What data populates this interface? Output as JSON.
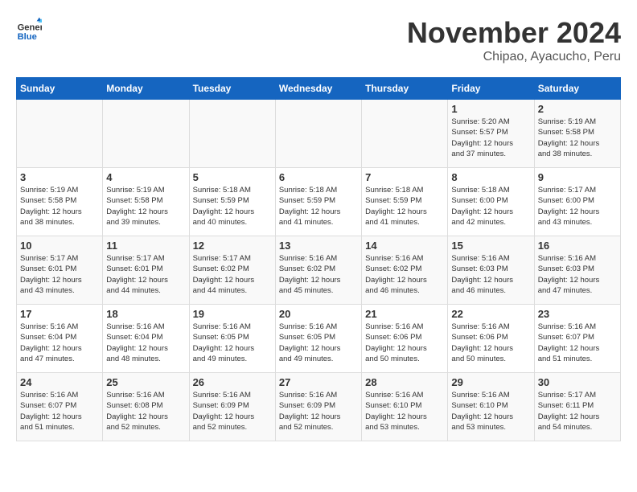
{
  "header": {
    "logo_general": "General",
    "logo_blue": "Blue",
    "month": "November 2024",
    "location": "Chipao, Ayacucho, Peru"
  },
  "days_of_week": [
    "Sunday",
    "Monday",
    "Tuesday",
    "Wednesday",
    "Thursday",
    "Friday",
    "Saturday"
  ],
  "weeks": [
    [
      {
        "day": "",
        "detail": ""
      },
      {
        "day": "",
        "detail": ""
      },
      {
        "day": "",
        "detail": ""
      },
      {
        "day": "",
        "detail": ""
      },
      {
        "day": "",
        "detail": ""
      },
      {
        "day": "1",
        "detail": "Sunrise: 5:20 AM\nSunset: 5:57 PM\nDaylight: 12 hours\nand 37 minutes."
      },
      {
        "day": "2",
        "detail": "Sunrise: 5:19 AM\nSunset: 5:58 PM\nDaylight: 12 hours\nand 38 minutes."
      }
    ],
    [
      {
        "day": "3",
        "detail": "Sunrise: 5:19 AM\nSunset: 5:58 PM\nDaylight: 12 hours\nand 38 minutes."
      },
      {
        "day": "4",
        "detail": "Sunrise: 5:19 AM\nSunset: 5:58 PM\nDaylight: 12 hours\nand 39 minutes."
      },
      {
        "day": "5",
        "detail": "Sunrise: 5:18 AM\nSunset: 5:59 PM\nDaylight: 12 hours\nand 40 minutes."
      },
      {
        "day": "6",
        "detail": "Sunrise: 5:18 AM\nSunset: 5:59 PM\nDaylight: 12 hours\nand 41 minutes."
      },
      {
        "day": "7",
        "detail": "Sunrise: 5:18 AM\nSunset: 5:59 PM\nDaylight: 12 hours\nand 41 minutes."
      },
      {
        "day": "8",
        "detail": "Sunrise: 5:18 AM\nSunset: 6:00 PM\nDaylight: 12 hours\nand 42 minutes."
      },
      {
        "day": "9",
        "detail": "Sunrise: 5:17 AM\nSunset: 6:00 PM\nDaylight: 12 hours\nand 43 minutes."
      }
    ],
    [
      {
        "day": "10",
        "detail": "Sunrise: 5:17 AM\nSunset: 6:01 PM\nDaylight: 12 hours\nand 43 minutes."
      },
      {
        "day": "11",
        "detail": "Sunrise: 5:17 AM\nSunset: 6:01 PM\nDaylight: 12 hours\nand 44 minutes."
      },
      {
        "day": "12",
        "detail": "Sunrise: 5:17 AM\nSunset: 6:02 PM\nDaylight: 12 hours\nand 44 minutes."
      },
      {
        "day": "13",
        "detail": "Sunrise: 5:16 AM\nSunset: 6:02 PM\nDaylight: 12 hours\nand 45 minutes."
      },
      {
        "day": "14",
        "detail": "Sunrise: 5:16 AM\nSunset: 6:02 PM\nDaylight: 12 hours\nand 46 minutes."
      },
      {
        "day": "15",
        "detail": "Sunrise: 5:16 AM\nSunset: 6:03 PM\nDaylight: 12 hours\nand 46 minutes."
      },
      {
        "day": "16",
        "detail": "Sunrise: 5:16 AM\nSunset: 6:03 PM\nDaylight: 12 hours\nand 47 minutes."
      }
    ],
    [
      {
        "day": "17",
        "detail": "Sunrise: 5:16 AM\nSunset: 6:04 PM\nDaylight: 12 hours\nand 47 minutes."
      },
      {
        "day": "18",
        "detail": "Sunrise: 5:16 AM\nSunset: 6:04 PM\nDaylight: 12 hours\nand 48 minutes."
      },
      {
        "day": "19",
        "detail": "Sunrise: 5:16 AM\nSunset: 6:05 PM\nDaylight: 12 hours\nand 49 minutes."
      },
      {
        "day": "20",
        "detail": "Sunrise: 5:16 AM\nSunset: 6:05 PM\nDaylight: 12 hours\nand 49 minutes."
      },
      {
        "day": "21",
        "detail": "Sunrise: 5:16 AM\nSunset: 6:06 PM\nDaylight: 12 hours\nand 50 minutes."
      },
      {
        "day": "22",
        "detail": "Sunrise: 5:16 AM\nSunset: 6:06 PM\nDaylight: 12 hours\nand 50 minutes."
      },
      {
        "day": "23",
        "detail": "Sunrise: 5:16 AM\nSunset: 6:07 PM\nDaylight: 12 hours\nand 51 minutes."
      }
    ],
    [
      {
        "day": "24",
        "detail": "Sunrise: 5:16 AM\nSunset: 6:07 PM\nDaylight: 12 hours\nand 51 minutes."
      },
      {
        "day": "25",
        "detail": "Sunrise: 5:16 AM\nSunset: 6:08 PM\nDaylight: 12 hours\nand 52 minutes."
      },
      {
        "day": "26",
        "detail": "Sunrise: 5:16 AM\nSunset: 6:09 PM\nDaylight: 12 hours\nand 52 minutes."
      },
      {
        "day": "27",
        "detail": "Sunrise: 5:16 AM\nSunset: 6:09 PM\nDaylight: 12 hours\nand 52 minutes."
      },
      {
        "day": "28",
        "detail": "Sunrise: 5:16 AM\nSunset: 6:10 PM\nDaylight: 12 hours\nand 53 minutes."
      },
      {
        "day": "29",
        "detail": "Sunrise: 5:16 AM\nSunset: 6:10 PM\nDaylight: 12 hours\nand 53 minutes."
      },
      {
        "day": "30",
        "detail": "Sunrise: 5:17 AM\nSunset: 6:11 PM\nDaylight: 12 hours\nand 54 minutes."
      }
    ]
  ]
}
